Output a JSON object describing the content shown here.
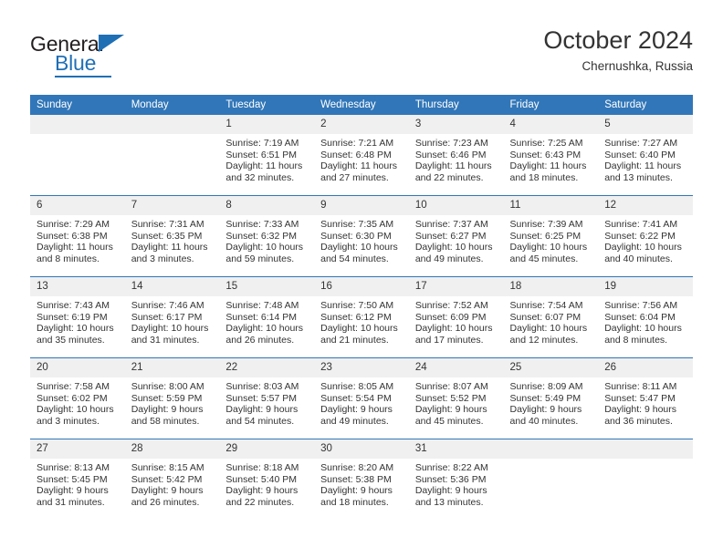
{
  "brand": {
    "name_top": "General",
    "name_bottom": "Blue",
    "triangle_color": "#1f6fb5",
    "text_color": "#231f20"
  },
  "header": {
    "title": "October 2024",
    "subtitle": "Chernushka, Russia"
  },
  "theme": {
    "header_bg": "#3176b8",
    "header_text": "#ffffff",
    "daynum_bg": "#f0f0f0",
    "body_text": "#333333",
    "row_divider": "#3176b8"
  },
  "weekday_headers": [
    "Sunday",
    "Monday",
    "Tuesday",
    "Wednesday",
    "Thursday",
    "Friday",
    "Saturday"
  ],
  "labels": {
    "sunrise_prefix": "Sunrise:",
    "sunset_prefix": "Sunset:",
    "daylight_prefix": "Daylight:"
  },
  "weeks": [
    [
      {
        "day": "",
        "blank": true,
        "sunrise": "",
        "sunset": "",
        "daylight_1": "",
        "daylight_2": ""
      },
      {
        "day": "",
        "blank": true,
        "sunrise": "",
        "sunset": "",
        "daylight_1": "",
        "daylight_2": ""
      },
      {
        "day": "1",
        "blank": false,
        "sunrise": "Sunrise: 7:19 AM",
        "sunset": "Sunset: 6:51 PM",
        "daylight_1": "Daylight: 11 hours",
        "daylight_2": "and 32 minutes."
      },
      {
        "day": "2",
        "blank": false,
        "sunrise": "Sunrise: 7:21 AM",
        "sunset": "Sunset: 6:48 PM",
        "daylight_1": "Daylight: 11 hours",
        "daylight_2": "and 27 minutes."
      },
      {
        "day": "3",
        "blank": false,
        "sunrise": "Sunrise: 7:23 AM",
        "sunset": "Sunset: 6:46 PM",
        "daylight_1": "Daylight: 11 hours",
        "daylight_2": "and 22 minutes."
      },
      {
        "day": "4",
        "blank": false,
        "sunrise": "Sunrise: 7:25 AM",
        "sunset": "Sunset: 6:43 PM",
        "daylight_1": "Daylight: 11 hours",
        "daylight_2": "and 18 minutes."
      },
      {
        "day": "5",
        "blank": false,
        "sunrise": "Sunrise: 7:27 AM",
        "sunset": "Sunset: 6:40 PM",
        "daylight_1": "Daylight: 11 hours",
        "daylight_2": "and 13 minutes."
      }
    ],
    [
      {
        "day": "6",
        "blank": false,
        "sunrise": "Sunrise: 7:29 AM",
        "sunset": "Sunset: 6:38 PM",
        "daylight_1": "Daylight: 11 hours",
        "daylight_2": "and 8 minutes."
      },
      {
        "day": "7",
        "blank": false,
        "sunrise": "Sunrise: 7:31 AM",
        "sunset": "Sunset: 6:35 PM",
        "daylight_1": "Daylight: 11 hours",
        "daylight_2": "and 3 minutes."
      },
      {
        "day": "8",
        "blank": false,
        "sunrise": "Sunrise: 7:33 AM",
        "sunset": "Sunset: 6:32 PM",
        "daylight_1": "Daylight: 10 hours",
        "daylight_2": "and 59 minutes."
      },
      {
        "day": "9",
        "blank": false,
        "sunrise": "Sunrise: 7:35 AM",
        "sunset": "Sunset: 6:30 PM",
        "daylight_1": "Daylight: 10 hours",
        "daylight_2": "and 54 minutes."
      },
      {
        "day": "10",
        "blank": false,
        "sunrise": "Sunrise: 7:37 AM",
        "sunset": "Sunset: 6:27 PM",
        "daylight_1": "Daylight: 10 hours",
        "daylight_2": "and 49 minutes."
      },
      {
        "day": "11",
        "blank": false,
        "sunrise": "Sunrise: 7:39 AM",
        "sunset": "Sunset: 6:25 PM",
        "daylight_1": "Daylight: 10 hours",
        "daylight_2": "and 45 minutes."
      },
      {
        "day": "12",
        "blank": false,
        "sunrise": "Sunrise: 7:41 AM",
        "sunset": "Sunset: 6:22 PM",
        "daylight_1": "Daylight: 10 hours",
        "daylight_2": "and 40 minutes."
      }
    ],
    [
      {
        "day": "13",
        "blank": false,
        "sunrise": "Sunrise: 7:43 AM",
        "sunset": "Sunset: 6:19 PM",
        "daylight_1": "Daylight: 10 hours",
        "daylight_2": "and 35 minutes."
      },
      {
        "day": "14",
        "blank": false,
        "sunrise": "Sunrise: 7:46 AM",
        "sunset": "Sunset: 6:17 PM",
        "daylight_1": "Daylight: 10 hours",
        "daylight_2": "and 31 minutes."
      },
      {
        "day": "15",
        "blank": false,
        "sunrise": "Sunrise: 7:48 AM",
        "sunset": "Sunset: 6:14 PM",
        "daylight_1": "Daylight: 10 hours",
        "daylight_2": "and 26 minutes."
      },
      {
        "day": "16",
        "blank": false,
        "sunrise": "Sunrise: 7:50 AM",
        "sunset": "Sunset: 6:12 PM",
        "daylight_1": "Daylight: 10 hours",
        "daylight_2": "and 21 minutes."
      },
      {
        "day": "17",
        "blank": false,
        "sunrise": "Sunrise: 7:52 AM",
        "sunset": "Sunset: 6:09 PM",
        "daylight_1": "Daylight: 10 hours",
        "daylight_2": "and 17 minutes."
      },
      {
        "day": "18",
        "blank": false,
        "sunrise": "Sunrise: 7:54 AM",
        "sunset": "Sunset: 6:07 PM",
        "daylight_1": "Daylight: 10 hours",
        "daylight_2": "and 12 minutes."
      },
      {
        "day": "19",
        "blank": false,
        "sunrise": "Sunrise: 7:56 AM",
        "sunset": "Sunset: 6:04 PM",
        "daylight_1": "Daylight: 10 hours",
        "daylight_2": "and 8 minutes."
      }
    ],
    [
      {
        "day": "20",
        "blank": false,
        "sunrise": "Sunrise: 7:58 AM",
        "sunset": "Sunset: 6:02 PM",
        "daylight_1": "Daylight: 10 hours",
        "daylight_2": "and 3 minutes."
      },
      {
        "day": "21",
        "blank": false,
        "sunrise": "Sunrise: 8:00 AM",
        "sunset": "Sunset: 5:59 PM",
        "daylight_1": "Daylight: 9 hours",
        "daylight_2": "and 58 minutes."
      },
      {
        "day": "22",
        "blank": false,
        "sunrise": "Sunrise: 8:03 AM",
        "sunset": "Sunset: 5:57 PM",
        "daylight_1": "Daylight: 9 hours",
        "daylight_2": "and 54 minutes."
      },
      {
        "day": "23",
        "blank": false,
        "sunrise": "Sunrise: 8:05 AM",
        "sunset": "Sunset: 5:54 PM",
        "daylight_1": "Daylight: 9 hours",
        "daylight_2": "and 49 minutes."
      },
      {
        "day": "24",
        "blank": false,
        "sunrise": "Sunrise: 8:07 AM",
        "sunset": "Sunset: 5:52 PM",
        "daylight_1": "Daylight: 9 hours",
        "daylight_2": "and 45 minutes."
      },
      {
        "day": "25",
        "blank": false,
        "sunrise": "Sunrise: 8:09 AM",
        "sunset": "Sunset: 5:49 PM",
        "daylight_1": "Daylight: 9 hours",
        "daylight_2": "and 40 minutes."
      },
      {
        "day": "26",
        "blank": false,
        "sunrise": "Sunrise: 8:11 AM",
        "sunset": "Sunset: 5:47 PM",
        "daylight_1": "Daylight: 9 hours",
        "daylight_2": "and 36 minutes."
      }
    ],
    [
      {
        "day": "27",
        "blank": false,
        "sunrise": "Sunrise: 8:13 AM",
        "sunset": "Sunset: 5:45 PM",
        "daylight_1": "Daylight: 9 hours",
        "daylight_2": "and 31 minutes."
      },
      {
        "day": "28",
        "blank": false,
        "sunrise": "Sunrise: 8:15 AM",
        "sunset": "Sunset: 5:42 PM",
        "daylight_1": "Daylight: 9 hours",
        "daylight_2": "and 26 minutes."
      },
      {
        "day": "29",
        "blank": false,
        "sunrise": "Sunrise: 8:18 AM",
        "sunset": "Sunset: 5:40 PM",
        "daylight_1": "Daylight: 9 hours",
        "daylight_2": "and 22 minutes."
      },
      {
        "day": "30",
        "blank": false,
        "sunrise": "Sunrise: 8:20 AM",
        "sunset": "Sunset: 5:38 PM",
        "daylight_1": "Daylight: 9 hours",
        "daylight_2": "and 18 minutes."
      },
      {
        "day": "31",
        "blank": false,
        "sunrise": "Sunrise: 8:22 AM",
        "sunset": "Sunset: 5:36 PM",
        "daylight_1": "Daylight: 9 hours",
        "daylight_2": "and 13 minutes."
      },
      {
        "day": "",
        "blank": true,
        "sunrise": "",
        "sunset": "",
        "daylight_1": "",
        "daylight_2": ""
      },
      {
        "day": "",
        "blank": true,
        "sunrise": "",
        "sunset": "",
        "daylight_1": "",
        "daylight_2": ""
      }
    ]
  ]
}
